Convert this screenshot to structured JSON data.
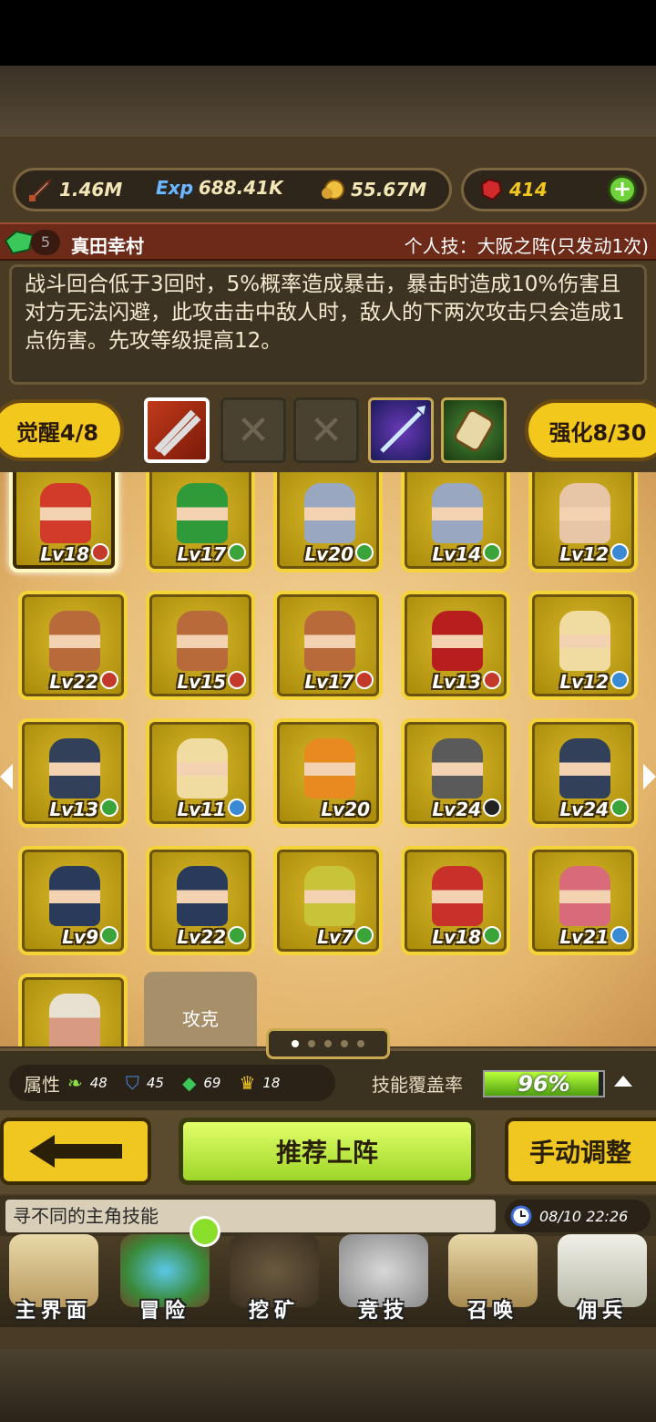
{
  "resources": {
    "attack": "1.46M",
    "exp": "688.41K",
    "gold": "55.67M",
    "gems": "414",
    "exp_icon_text": "Exp"
  },
  "hero": {
    "name": "真田幸村",
    "level_badge": "5",
    "skill": "个人技：大阪之阵(只发动1次)",
    "description": "战斗回合低于3回时，5%概率造成暴击，暴击时造成10%伤害且对方无法闪避，此攻击击中敌人时，敌人的下两次攻击只会造成1点伤害。先攻等级提高12。"
  },
  "awaken": {
    "label": "觉醒4/8",
    "upgrade": "强化8/30"
  },
  "cards": [
    {
      "lv": "Lv18",
      "badge": "down",
      "color": "#d23a2a"
    },
    {
      "lv": "Lv17",
      "badge": "plus",
      "color": "#2f9a3a"
    },
    {
      "lv": "Lv20",
      "badge": "plus",
      "color": "#9aa7c0"
    },
    {
      "lv": "Lv14",
      "badge": "plus",
      "color": "#9aa7c0"
    },
    {
      "lv": "Lv12",
      "badge": "star",
      "color": "#e7c6a8"
    },
    {
      "lv": "Lv22",
      "badge": "down",
      "color": "#b86a3a"
    },
    {
      "lv": "Lv15",
      "badge": "down",
      "color": "#b86a3a"
    },
    {
      "lv": "Lv17",
      "badge": "down",
      "color": "#b86a3a"
    },
    {
      "lv": "Lv13",
      "badge": "down",
      "color": "#b81e1e"
    },
    {
      "lv": "Lv12",
      "badge": "star",
      "color": "#f0dca0"
    },
    {
      "lv": "Lv13",
      "badge": "plus",
      "color": "#33405a"
    },
    {
      "lv": "Lv11",
      "badge": "star",
      "color": "#f0dca0"
    },
    {
      "lv": "Lv20",
      "badge": "",
      "color": "#e88a20"
    },
    {
      "lv": "Lv24",
      "badge": "q",
      "color": "#5a5a5a"
    },
    {
      "lv": "Lv24",
      "badge": "plus",
      "color": "#33405a"
    },
    {
      "lv": "Lv9",
      "badge": "plus",
      "color": "#2a3a5a"
    },
    {
      "lv": "Lv22",
      "badge": "plus",
      "color": "#2a3a5a"
    },
    {
      "lv": "Lv7",
      "badge": "plus",
      "color": "#c8c43a"
    },
    {
      "lv": "Lv18",
      "badge": "plus",
      "color": "#c8302a"
    },
    {
      "lv": "Lv21",
      "badge": "star",
      "color": "#d86a7a"
    }
  ],
  "partial_card_label": "攻克",
  "attributes": {
    "label": "属性",
    "values": [
      "48",
      "45",
      "69",
      "18"
    ]
  },
  "coverage": {
    "label": "技能覆盖率",
    "value": "96%",
    "fraction": 0.96
  },
  "buttons": {
    "recommend": "推荐上阵",
    "manual": "手动调整"
  },
  "tip": "寻不同的主角技能",
  "time": "08/10 22:26",
  "nav": [
    "主界面",
    "冒险",
    "挖矿",
    "竞技",
    "召唤",
    "佣兵"
  ]
}
